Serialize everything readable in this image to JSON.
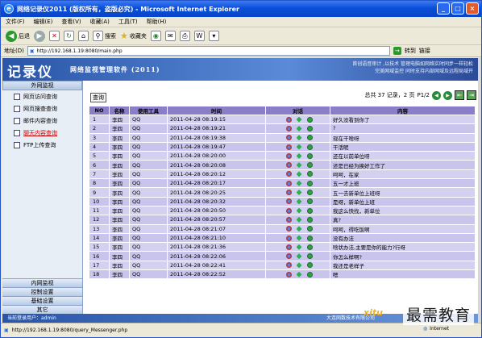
{
  "window": {
    "title": "网络记录仪2011 (版权所有，盗版必究) - Microsoft Internet Explorer",
    "ie_badge": "e",
    "min_label": "_",
    "max_label": "□",
    "close_label": "×"
  },
  "menu": [
    "文件(F)",
    "编辑(E)",
    "查看(V)",
    "收藏(A)",
    "工具(T)",
    "帮助(H)"
  ],
  "toolbar": {
    "back": "后退",
    "search": "搜索",
    "favorites": "收藏夹",
    "back_glyph": "◀",
    "forward_glyph": "▶",
    "stop_glyph": "✕",
    "refresh_glyph": "↻",
    "home_glyph": "⌂",
    "history_glyph": "◉",
    "mail_glyph": "✉",
    "print_glyph": "⎙",
    "edit_glyph": "W",
    "more_glyph": "▾"
  },
  "address": {
    "label": "地址(D)",
    "url": "http://192.168.1.19:8080/main.php",
    "go": "转到",
    "links": "链接",
    "go_glyph": "→"
  },
  "banner": {
    "logo": "记录仪",
    "subtitle": "网络监视管理软件 (2011)",
    "slogan_1": "首创语音审计 ,以技术 管理电脑如网络实时同步一样轻松",
    "slogan_2": "完美网域监控 同时支持内部网域及远程局域开"
  },
  "sidebar": {
    "head": "外网监视",
    "items": [
      "网页访问查询",
      "网页搜查查询",
      "邮件内容查询",
      "聊天内容查询",
      "FTP上传查询"
    ],
    "active_index": 3,
    "bottom": [
      "内网监视",
      "控制设置",
      "基础设置",
      "其它"
    ]
  },
  "main": {
    "query_button": "查询",
    "total_text": "总共 37 记录，2 页",
    "page_text": "P1/2",
    "prev_glyph": "◀",
    "next_glyph": "▶",
    "first_glyph": "⇤",
    "last_glyph": "⇥"
  },
  "table": {
    "headers": [
      "NO",
      "名称",
      "使用工具",
      "时间",
      "对话",
      "内容"
    ],
    "rows": [
      [
        "1",
        "李四",
        "QQ",
        "2011-04-28 08:19:15",
        "好久没看到你了"
      ],
      [
        "2",
        "李四",
        "QQ",
        "2011-04-28 08:19:21",
        "?"
      ],
      [
        "3",
        "李四",
        "QQ",
        "2011-04-28 08:19:38",
        "现在干啥呀"
      ],
      [
        "4",
        "李四",
        "QQ",
        "2011-04-28 08:19:47",
        "干活呢"
      ],
      [
        "5",
        "李四",
        "QQ",
        "2011-04-28 08:20:00",
        "还在以前单位呀"
      ],
      [
        "6",
        "李四",
        "QQ",
        "2011-04-28 08:20:08",
        "还是已经为换好工作了"
      ],
      [
        "7",
        "李四",
        "QQ",
        "2011-04-28 08:20:12",
        "呵呵，在家"
      ],
      [
        "8",
        "李四",
        "QQ",
        "2011-04-28 08:20:17",
        "五一才上班"
      ],
      [
        "9",
        "李四",
        "QQ",
        "2011-04-28 08:20:25",
        "五一去新单位上班呀"
      ],
      [
        "10",
        "李四",
        "QQ",
        "2011-04-28 08:20:32",
        "是呀，新单位上班"
      ],
      [
        "11",
        "李四",
        "QQ",
        "2011-04-28 08:20:50",
        "我这么快找，新单位"
      ],
      [
        "12",
        "李四",
        "QQ",
        "2011-04-28 08:20:57",
        "真?"
      ],
      [
        "13",
        "李四",
        "QQ",
        "2011-04-28 08:21:07",
        "呵呵，得吃饭啊"
      ],
      [
        "14",
        "李四",
        "QQ",
        "2011-04-28 08:21:10",
        "没有办法"
      ],
      [
        "15",
        "李四",
        "QQ",
        "2011-04-28 08:21:36",
        "啥状办法,主要是你的能力?行呀"
      ],
      [
        "16",
        "李四",
        "QQ",
        "2011-04-28 08:22:06",
        "你怎么样啊?"
      ],
      [
        "17",
        "李四",
        "QQ",
        "2011-04-28 08:22:41",
        "我还是老样子"
      ],
      [
        "18",
        "李四",
        "QQ",
        "2011-04-28 08:22:52",
        "嗯"
      ]
    ]
  },
  "statusrow": {
    "left": "当前登录用户：admin",
    "right": "大连网数技术有限公司"
  },
  "statusbar": {
    "url": "http://192.168.1.19:8080/query_Messenger.php",
    "zone": "Internet"
  },
  "watermark": {
    "text": "最需教育",
    "brand": "xitu"
  }
}
